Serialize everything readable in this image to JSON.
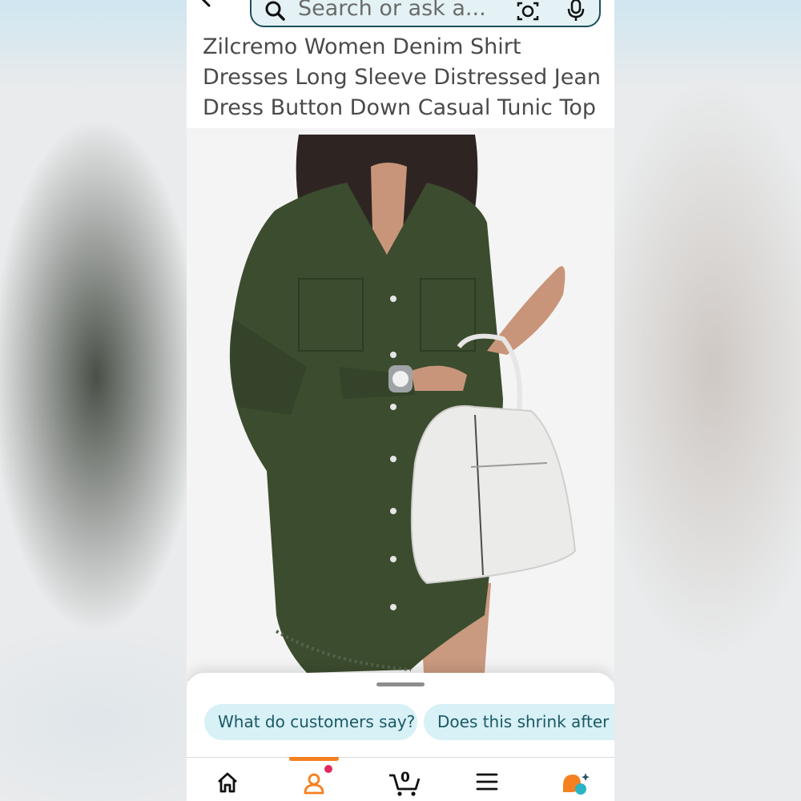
{
  "search": {
    "placeholder": "Search or ask a..."
  },
  "product": {
    "title": "Zilcremo Women Denim Shirt Dresses Long Sleeve Distressed Jean Dress Button Down Casual Tunic Top",
    "image_alt": "Woman wearing green denim shirt dress holding white handbag"
  },
  "suggestions": [
    {
      "label": "What do customers say?"
    },
    {
      "label": "Does this shrink after w"
    }
  ],
  "nav": {
    "cart_count": "0",
    "active_item": "account"
  },
  "icons": {
    "back": "arrow-left",
    "search": "magnifier",
    "lens": "camera-lens",
    "mic": "microphone",
    "home": "house",
    "account": "person",
    "cart": "cart",
    "menu": "hamburger",
    "rufus": "rufus-assistant"
  },
  "colors": {
    "accent": "#f5801f",
    "search_border": "#1d4f5c",
    "search_bg": "#e4f2f6",
    "chip_bg": "#d7f1f6",
    "chip_text": "#1c5866",
    "dress": "#3c4c2e",
    "notification": "#e0295f",
    "rufus_teal": "#2bb3c6"
  }
}
